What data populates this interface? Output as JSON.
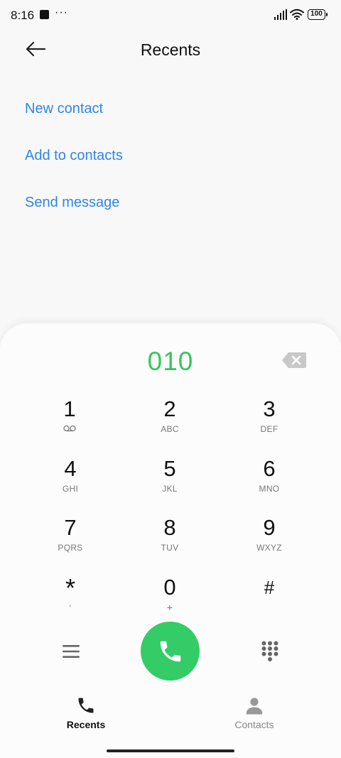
{
  "status_bar": {
    "time": "8:16",
    "dots": "···",
    "battery": "100"
  },
  "header": {
    "title": "Recents",
    "back_icon": "arrow-left-icon"
  },
  "actions": [
    {
      "label": "New contact"
    },
    {
      "label": "Add to contacts"
    },
    {
      "label": "Send message"
    }
  ],
  "dialer": {
    "number": "010",
    "number_color": "#34c759",
    "keys": [
      {
        "digit": "1",
        "letters": ""
      },
      {
        "digit": "2",
        "letters": "ABC"
      },
      {
        "digit": "3",
        "letters": "DEF"
      },
      {
        "digit": "4",
        "letters": "GHI"
      },
      {
        "digit": "5",
        "letters": "JKL"
      },
      {
        "digit": "6",
        "letters": "MNO"
      },
      {
        "digit": "7",
        "letters": "PQRS"
      },
      {
        "digit": "8",
        "letters": "TUV"
      },
      {
        "digit": "9",
        "letters": "WXYZ"
      },
      {
        "digit": "*",
        "letters": ","
      },
      {
        "digit": "0",
        "letters": "+"
      },
      {
        "digit": "#",
        "letters": ""
      }
    ],
    "call_color": "#33cc66"
  },
  "bottom_nav": {
    "recents_label": "Recents",
    "contacts_label": "Contacts"
  },
  "colors": {
    "link": "#2f86e8",
    "background": "#f8f8f8"
  }
}
